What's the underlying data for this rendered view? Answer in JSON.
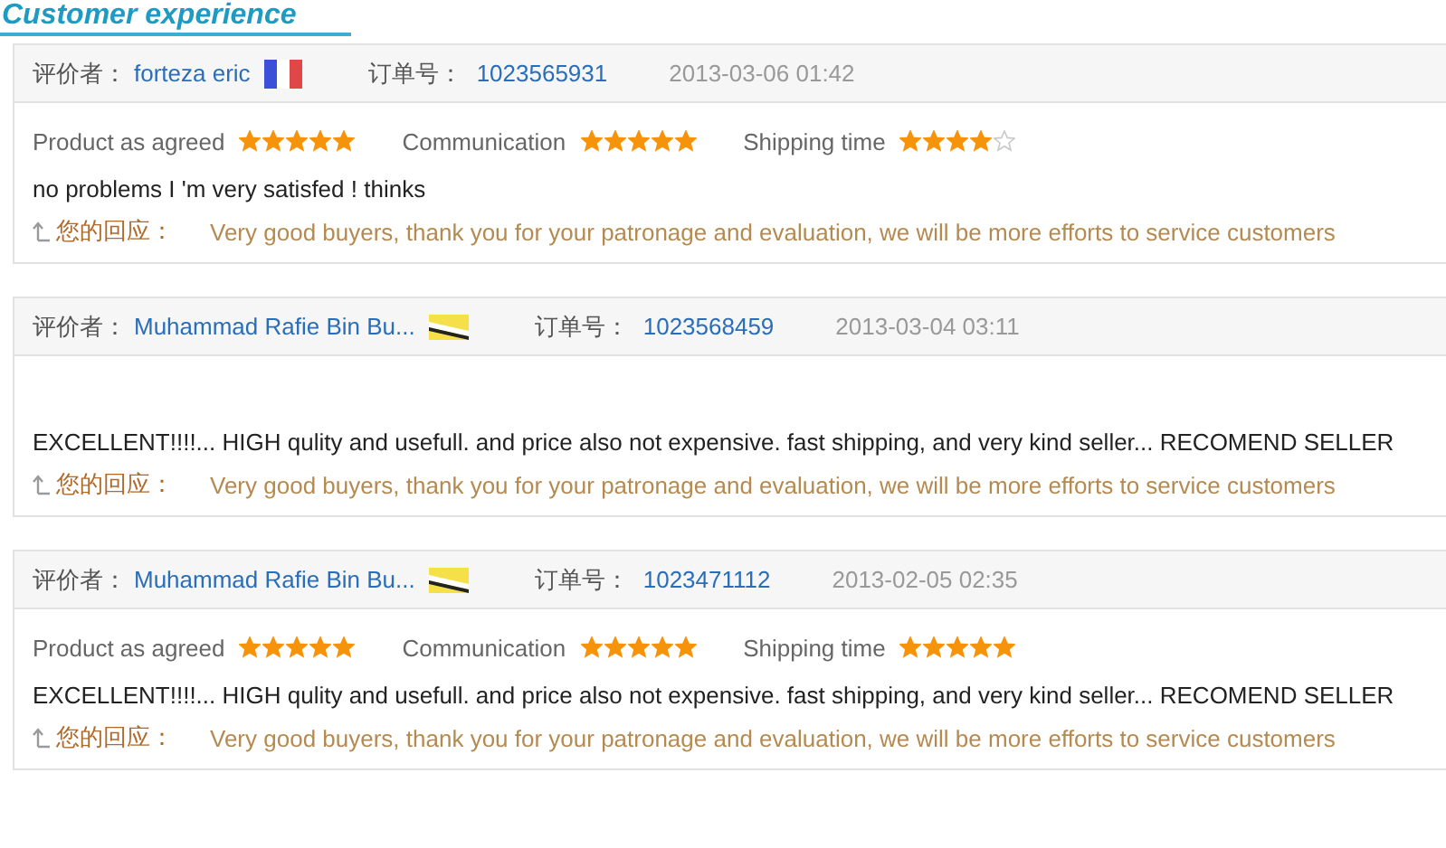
{
  "title": "Customer experience",
  "reviews": [
    {
      "reviewer_label": "评价者：",
      "reviewer": "forteza eric",
      "flag": {
        "kind": "france"
      },
      "order_label": "订单号：",
      "order": "1023565931",
      "date": "2013-03-06 01:42",
      "ratings": [
        {
          "label": "Product as agreed",
          "stars": 5
        },
        {
          "label": "Communication",
          "stars": 5
        },
        {
          "label": "Shipping time",
          "stars": 4
        }
      ],
      "comment": "no problems I 'm very satisfed ! thinks",
      "reply_label": "您的回应：",
      "reply": "Very good buyers, thank you for your patronage and evaluation, we will be more efforts to service customers"
    },
    {
      "reviewer_label": "评价者：",
      "reviewer": "Muhammad Rafie Bin Bu...",
      "flag": {
        "kind": "brunei"
      },
      "order_label": "订单号：",
      "order": "1023568459",
      "date": "2013-03-04 03:11",
      "comment": "EXCELLENT!!!!... HIGH qulity and usefull. and price also not expensive. fast shipping, and very kind seller... RECOMEND SELLER",
      "reply_label": "您的回应：",
      "reply": "Very good buyers, thank you for your patronage and evaluation, we will be more efforts to service customers"
    },
    {
      "reviewer_label": "评价者：",
      "reviewer": "Muhammad Rafie Bin Bu...",
      "flag": {
        "kind": "brunei"
      },
      "order_label": "订单号：",
      "order": "1023471112",
      "date": "2013-02-05 02:35",
      "ratings": [
        {
          "label": "Product as agreed",
          "stars": 5
        },
        {
          "label": "Communication",
          "stars": 5
        },
        {
          "label": "Shipping time",
          "stars": 5
        }
      ],
      "comment": "EXCELLENT!!!!... HIGH qulity and usefull. and price also not expensive. fast shipping, and very kind seller... RECOMEND SELLER",
      "reply_label": "您的回应：",
      "reply": "Very good buyers, thank you for your patronage and evaluation, we will be more efforts to service customers"
    }
  ]
}
